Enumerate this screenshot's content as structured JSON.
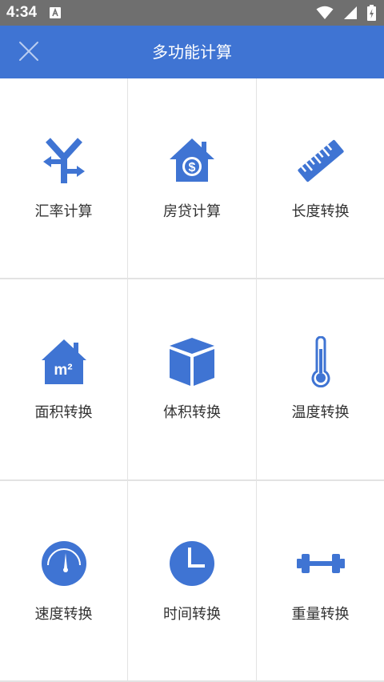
{
  "status_bar": {
    "time": "4:34",
    "notification_icon": "app-a-icon",
    "icons": [
      "wifi-icon",
      "signal-icon",
      "battery-charging-icon"
    ]
  },
  "header": {
    "title": "多功能计算",
    "close_icon": "close-icon",
    "background": "#3f74d3"
  },
  "accent_color": "#3f74d3",
  "tools": [
    {
      "label": "汇率计算",
      "icon": "yen-exchange-icon"
    },
    {
      "label": "房贷计算",
      "icon": "house-dollar-icon"
    },
    {
      "label": "长度转换",
      "icon": "ruler-icon"
    },
    {
      "label": "面积转换",
      "icon": "house-m2-icon"
    },
    {
      "label": "体积转换",
      "icon": "cube-icon"
    },
    {
      "label": "温度转换",
      "icon": "thermometer-icon"
    },
    {
      "label": "速度转换",
      "icon": "speedometer-icon"
    },
    {
      "label": "时间转换",
      "icon": "clock-icon"
    },
    {
      "label": "重量转换",
      "icon": "dumbbell-icon"
    }
  ]
}
